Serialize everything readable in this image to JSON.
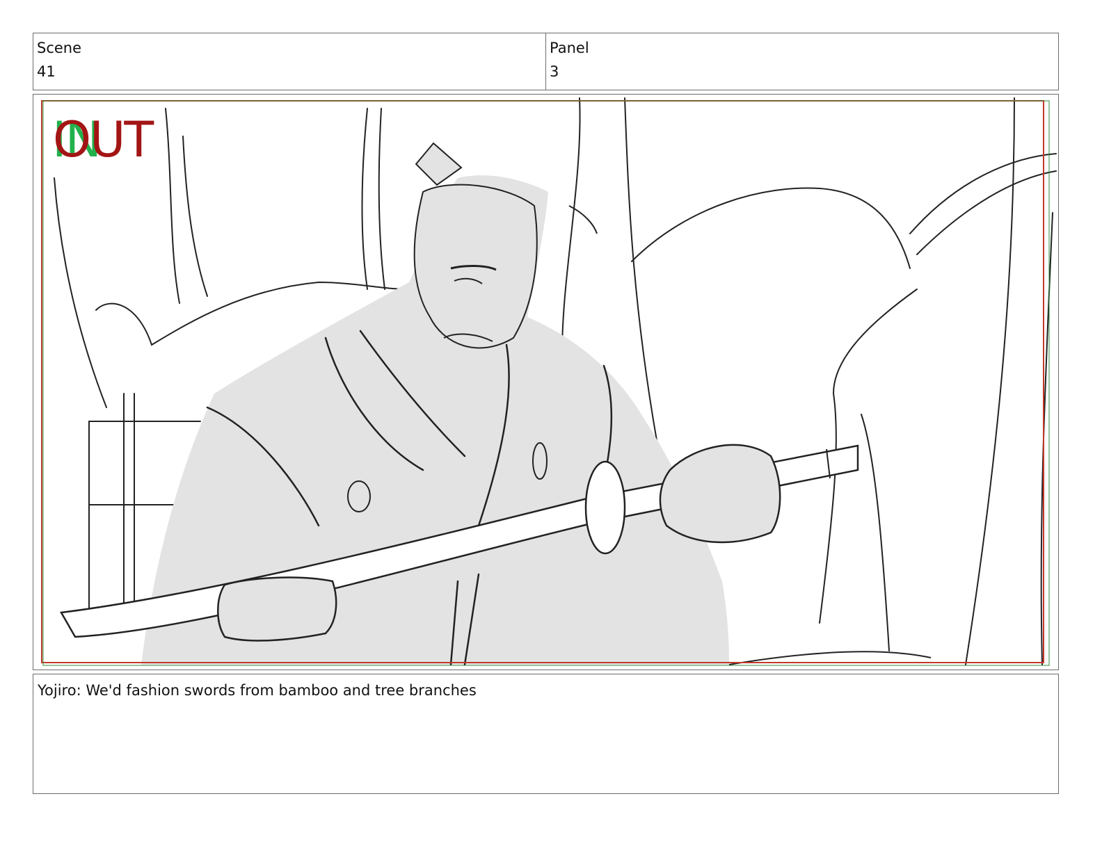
{
  "header": {
    "scene_label": "Scene",
    "scene_value": "41",
    "panel_label": "Panel",
    "panel_value": "3"
  },
  "frame": {
    "in_marker": "IN",
    "out_marker": "OUT",
    "safe_area_color": "#c0392b",
    "title_safe_color": "#2e8b3a"
  },
  "caption": {
    "text": "Yojiro: We'd fashion swords from bamboo and tree branches"
  }
}
